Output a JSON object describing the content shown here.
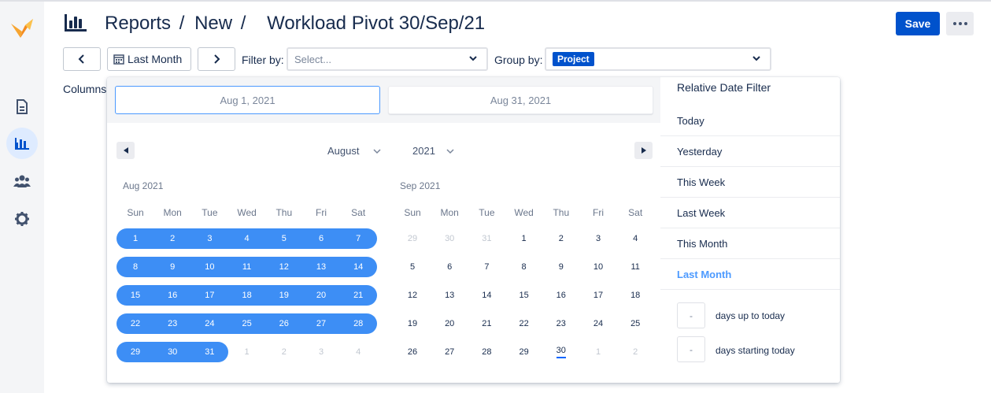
{
  "header": {
    "breadcrumb_reports": "Reports",
    "breadcrumb_new": "New",
    "separator1": "/",
    "separator2": "/",
    "page_name": "Workload Pivot 30/Sep/21",
    "save_label": "Save"
  },
  "toolbar": {
    "date_range_label": "Last Month",
    "filter_by_label": "Filter by:",
    "filter_placeholder": "Select...",
    "group_by_label": "Group by:",
    "group_tag": "Project",
    "columns_label": "Columns"
  },
  "datepicker": {
    "start_date": "Aug 1, 2021",
    "end_date": "Aug 31, 2021",
    "month_select": "August",
    "year_select": "2021",
    "weekdays": [
      "Sun",
      "Mon",
      "Tue",
      "Wed",
      "Thu",
      "Fri",
      "Sat"
    ],
    "months": [
      {
        "title": "Aug 2021",
        "weeks": [
          [
            "1",
            "2",
            "3",
            "4",
            "5",
            "6",
            "7"
          ],
          [
            "8",
            "9",
            "10",
            "11",
            "12",
            "13",
            "14"
          ],
          [
            "15",
            "16",
            "17",
            "18",
            "19",
            "20",
            "21"
          ],
          [
            "22",
            "23",
            "24",
            "25",
            "26",
            "27",
            "28"
          ],
          [
            "29",
            "30",
            "31",
            "1",
            "2",
            "3",
            "4"
          ]
        ],
        "selected_through": 31
      },
      {
        "title": "Sep 2021",
        "weeks": [
          [
            "29",
            "30",
            "31",
            "1",
            "2",
            "3",
            "4"
          ],
          [
            "5",
            "6",
            "7",
            "8",
            "9",
            "10",
            "11"
          ],
          [
            "12",
            "13",
            "14",
            "15",
            "16",
            "17",
            "18"
          ],
          [
            "19",
            "20",
            "21",
            "22",
            "23",
            "24",
            "25"
          ],
          [
            "26",
            "27",
            "28",
            "29",
            "30",
            "1",
            "2"
          ]
        ],
        "today": "30"
      }
    ]
  },
  "relative_filter": {
    "title": "Relative Date Filter",
    "items": [
      "Today",
      "Yesterday",
      "This Week",
      "Last Week",
      "This Month",
      "Last Month"
    ],
    "active_item": "Last Month",
    "days_up_value": "-",
    "days_up_label": "days up to today",
    "days_start_value": "-",
    "days_start_label": "days starting today"
  },
  "colors": {
    "accent": "#0052cc",
    "range": "#3d8ef5",
    "active_link": "#4c9aff"
  },
  "icons": {
    "logo": "app-logo-icon",
    "reports_header": "bar-chart-icon",
    "sidebar": [
      "document-icon",
      "bar-chart-icon",
      "users-icon",
      "gear-icon"
    ]
  }
}
